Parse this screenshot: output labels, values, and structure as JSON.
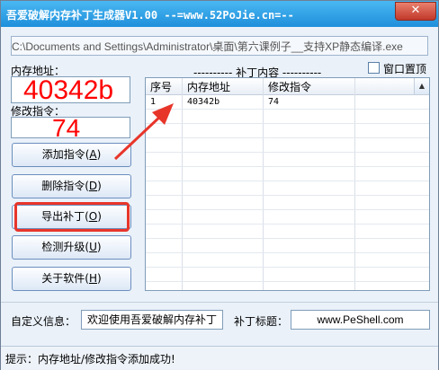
{
  "window": {
    "title": "吾爱破解内存补丁生成器V1.00  --=www.52PoJie.cn=--",
    "close_label": "✕"
  },
  "path": "C:\\Documents and Settings\\Administrator\\桌面\\第六课例子__支持XP静态编译.exe",
  "address": {
    "label": "内存地址：",
    "value": "40342b"
  },
  "instruction": {
    "label": "修改指令：",
    "value": "74"
  },
  "buttons": [
    {
      "label": "添加指令(",
      "key": "A"
    },
    {
      "label": "删除指令(",
      "key": "D"
    },
    {
      "label": "导出补丁(",
      "key": "O"
    },
    {
      "label": "检测升级(",
      "key": "U"
    },
    {
      "label": "关于软件(",
      "key": "H"
    }
  ],
  "patch_panel": {
    "title": "---------- 补丁内容 ----------",
    "topmost_label": "窗口置顶",
    "columns": [
      "序号",
      "内存地址",
      "修改指令"
    ],
    "rows": [
      {
        "index": "1",
        "address": "40342b",
        "instruction": "74"
      }
    ]
  },
  "custom_info": {
    "label": "自定义信息：",
    "value": "欢迎使用吾爱破解内存补丁"
  },
  "patch_title": {
    "label": "补丁标题：",
    "value": "www.PeShell.com"
  },
  "status": "提示：内存地址/修改指令添加成功!",
  "colors": {
    "annotation": "#e8352a",
    "title_bar": "#1f8fdb",
    "input_text": "#ff0000"
  }
}
